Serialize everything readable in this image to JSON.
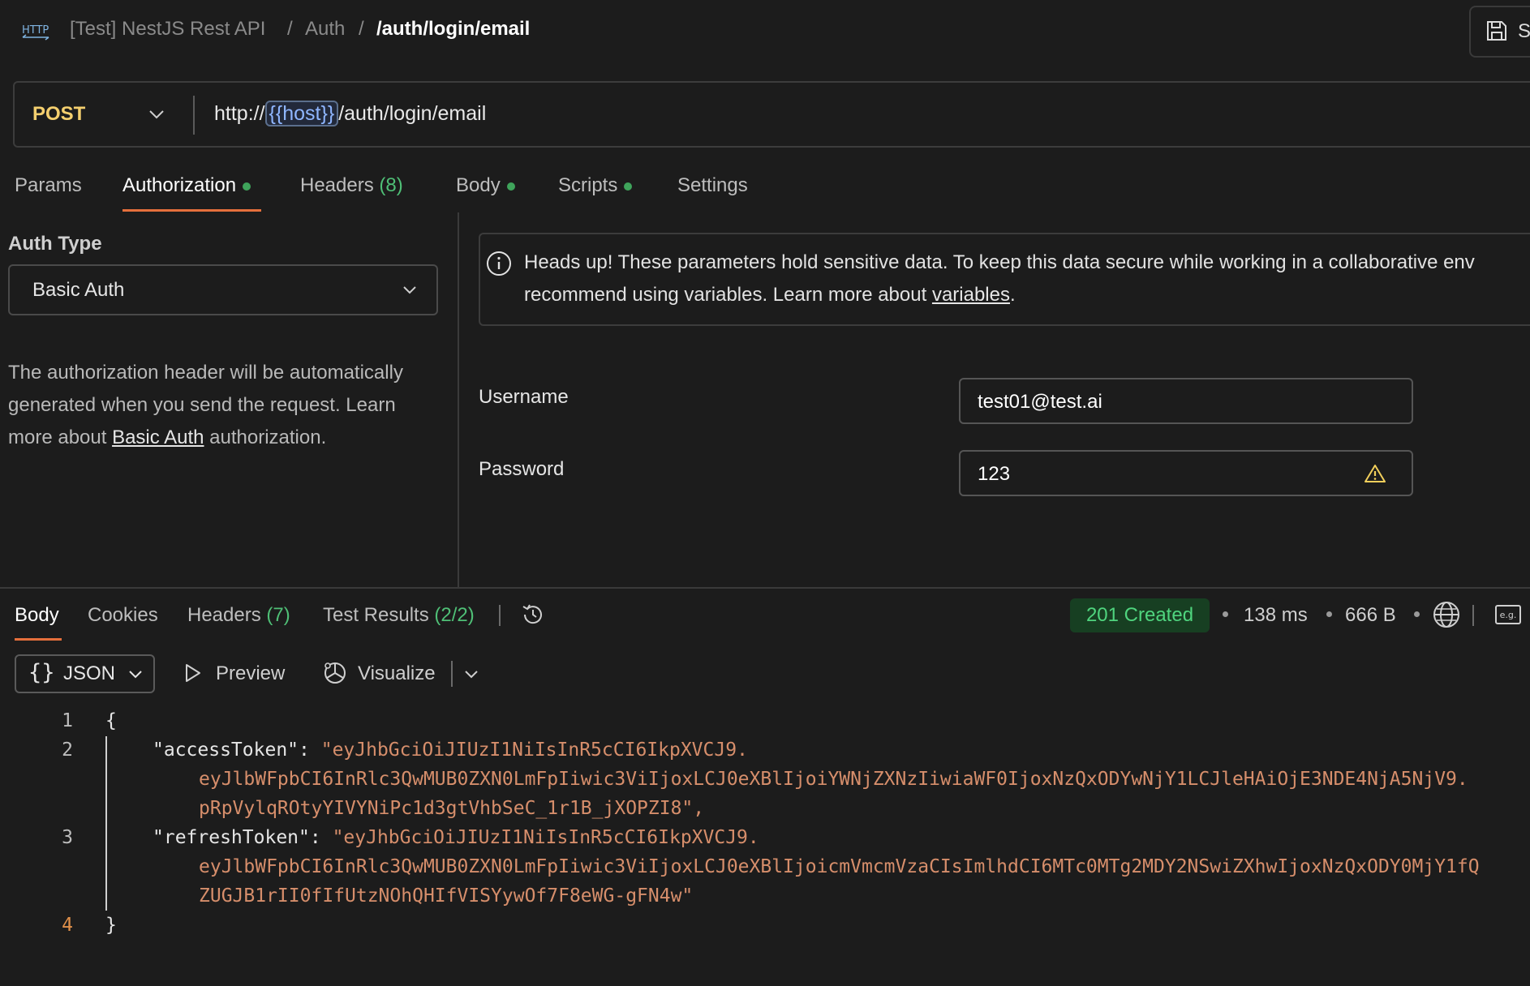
{
  "breadcrumb": {
    "collection": "[Test] NestJS Rest API",
    "sep1": "/",
    "folder": "Auth",
    "sep2": "/",
    "request": "/auth/login/email"
  },
  "save_button": {
    "label": "S"
  },
  "request": {
    "method": "POST",
    "url_prefix": "http://",
    "url_variable": "{{host}}",
    "url_path": "/auth/login/email"
  },
  "request_tabs": {
    "params": "Params",
    "authorization": "Authorization",
    "headers": "Headers",
    "headers_count": "(8)",
    "body": "Body",
    "scripts": "Scripts",
    "settings": "Settings"
  },
  "auth": {
    "type_label": "Auth Type",
    "type_value": "Basic Auth",
    "description_before": "The authorization header will be automatically generated when you send the request. Learn more about ",
    "description_link": "Basic Auth",
    "description_after": " authorization.",
    "banner_line1": "Heads up! These parameters hold sensitive data. To keep this data secure while working in a collaborative env",
    "banner_line2_before": "recommend using variables. Learn more about ",
    "banner_link": "variables",
    "banner_line2_after": ".",
    "username_label": "Username",
    "username_value": "test01@test.ai",
    "password_label": "Password",
    "password_value": "123"
  },
  "response_tabs": {
    "body": "Body",
    "cookies": "Cookies",
    "headers": "Headers",
    "headers_count": "(7)",
    "test_results": "Test Results",
    "test_results_count": "(2/2)"
  },
  "response_meta": {
    "status": "201 Created",
    "time": "138 ms",
    "size": "666 B",
    "example_icon_text": "e.g."
  },
  "response_toolbar": {
    "format": "JSON",
    "format_icon": "{}",
    "preview": "Preview",
    "visualize": "Visualize"
  },
  "code": {
    "line_numbers": [
      "1",
      "2",
      "3",
      "4"
    ],
    "open_brace": "{",
    "close_brace": "}",
    "access_key": "\"accessToken\": ",
    "access_val_1": "\"eyJhbGciOiJIUzI1NiIsInR5cCI6IkpXVCJ9.",
    "access_val_2": "eyJlbWFpbCI6InRlc3QwMUB0ZXN0LmFpIiwic3ViIjoxLCJ0eXBlIjoiYWNjZXNzIiwiaWF0IjoxNzQxODYwNjY1LCJleHAiOjE3NDE4NjA5NjV9.",
    "access_val_3": "pRpVylqROtyYIVYNiPc1d3gtVhbSeC_1r1B_jXOPZI8\",",
    "refresh_key": "\"refreshToken\": ",
    "refresh_val_1": "\"eyJhbGciOiJIUzI1NiIsInR5cCI6IkpXVCJ9.",
    "refresh_val_2": "eyJlbWFpbCI6InRlc3QwMUB0ZXN0LmFpIiwic3ViIjoxLCJ0eXBlIjoicmVmcmVzaCIsImlhdCI6MTc0MTg2MDY2NSwiZXhwIjoxNzQxODY0MjY1fQ",
    "refresh_val_3": "ZUGJB1rII0fIfUtzNOhQHIfVISYywOf7F8eWG-gFN4w\""
  },
  "icons": {
    "http": "http-icon",
    "save": "save-icon",
    "chevron": "chevron-down-icon",
    "info": "info-icon",
    "warning": "warning-icon",
    "history": "history-icon",
    "globe": "globe-icon",
    "play": "play-icon",
    "visualize": "visualize-icon"
  },
  "colors": {
    "accent": "#e56f3c",
    "method": "#f4cf6e",
    "success": "#4fd47e",
    "string": "#d68e6b",
    "variable": "#8fb6ff"
  }
}
